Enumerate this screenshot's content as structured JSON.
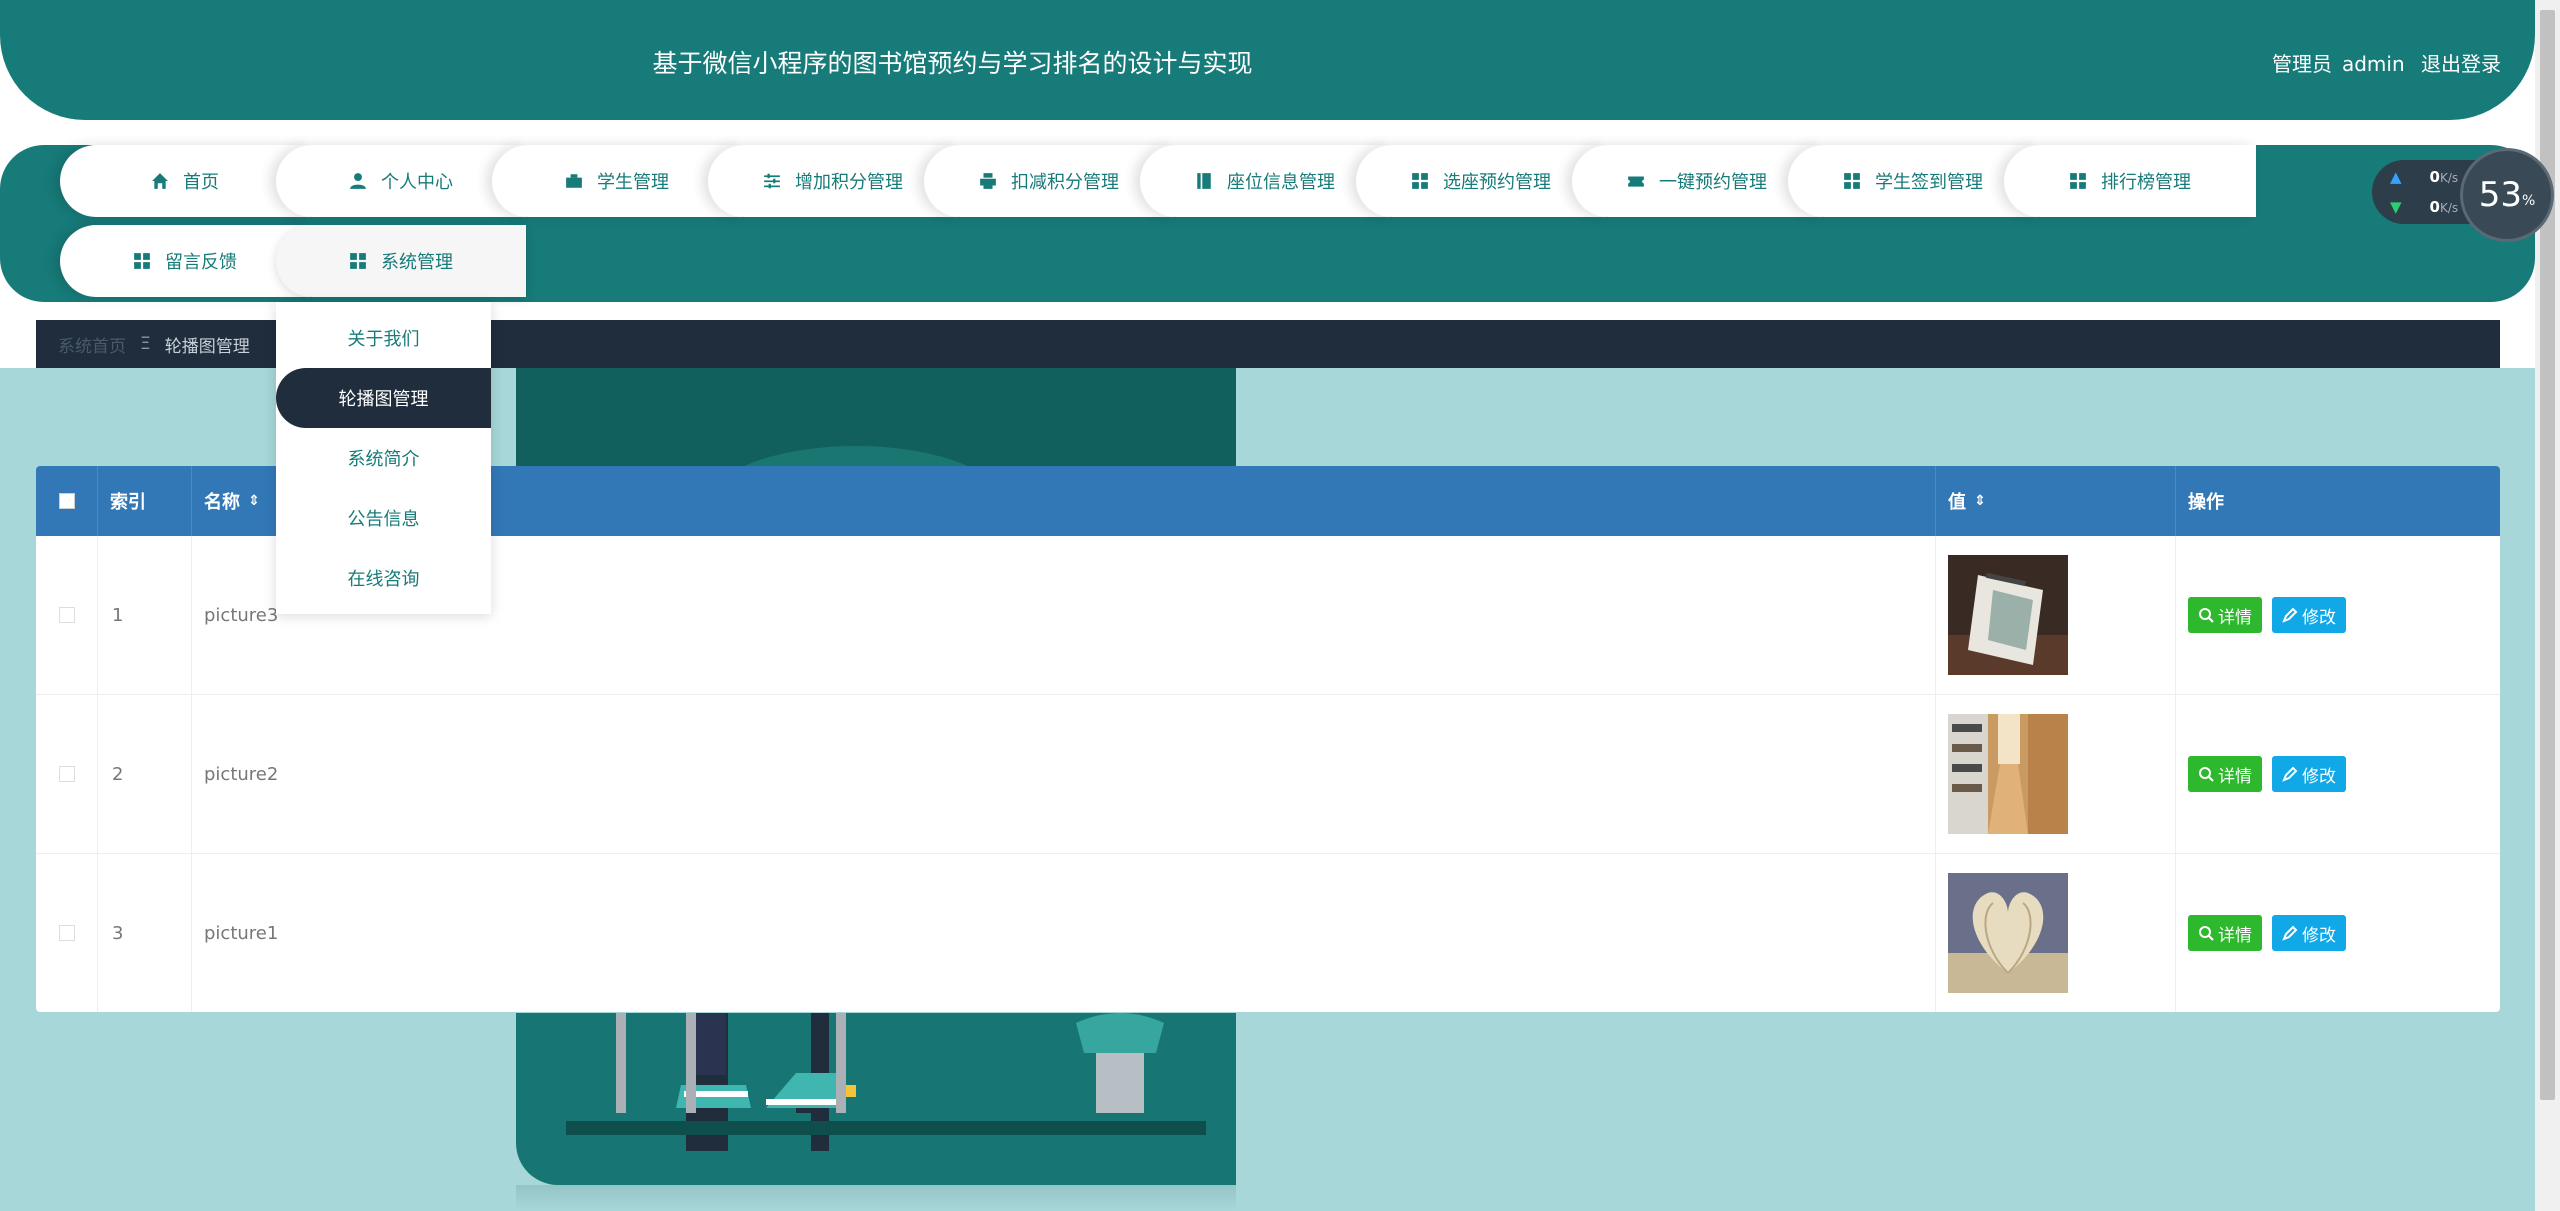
{
  "header": {
    "title": "基于微信小程序的图书馆预约与学习排名的设计与实现",
    "role": "管理员",
    "username": "admin",
    "logout": "退出登录"
  },
  "nav": {
    "items": [
      {
        "label": "首页",
        "icon": "home-icon"
      },
      {
        "label": "个人中心",
        "icon": "user-icon"
      },
      {
        "label": "学生管理",
        "icon": "briefcase-icon"
      },
      {
        "label": "增加积分管理",
        "icon": "sliders-icon"
      },
      {
        "label": "扣减积分管理",
        "icon": "printer-icon"
      },
      {
        "label": "座位信息管理",
        "icon": "book-icon"
      },
      {
        "label": "选座预约管理",
        "icon": "grid-icon"
      },
      {
        "label": "一键预约管理",
        "icon": "ticket-icon"
      },
      {
        "label": "学生签到管理",
        "icon": "grid-icon"
      },
      {
        "label": "排行榜管理",
        "icon": "grid-icon"
      },
      {
        "label": "留言反馈",
        "icon": "grid-icon"
      },
      {
        "label": "系统管理",
        "icon": "grid-icon"
      }
    ],
    "dropdown": [
      "关于我们",
      "轮播图管理",
      "系统简介",
      "公告信息",
      "在线咨询"
    ]
  },
  "speed": {
    "up_value": "0",
    "up_unit": "K/s",
    "down_value": "0",
    "down_unit": "K/s",
    "percent": "53",
    "percent_unit": "%"
  },
  "breadcrumb": {
    "home": "系统首页",
    "separator": "Ξ",
    "current": "轮播图管理"
  },
  "table": {
    "headers": {
      "index": "索引",
      "name": "名称",
      "value": "值",
      "action": "操作"
    },
    "sort_icon": "⇕",
    "detail_label": "详情",
    "edit_label": "修改",
    "rows": [
      {
        "index": "1",
        "name": "picture3",
        "image": "book-on-desk-thumb"
      },
      {
        "index": "2",
        "name": "picture2",
        "image": "library-aisle-thumb"
      },
      {
        "index": "3",
        "name": "picture1",
        "image": "open-book-heart-thumb"
      }
    ]
  },
  "colors": {
    "primary": "#177b79",
    "dark": "#1f2d3d",
    "table_header": "#3278b7",
    "detail_button": "#2db82d",
    "edit_button": "#11a8e8",
    "content_bg": "#a7d7d8"
  }
}
